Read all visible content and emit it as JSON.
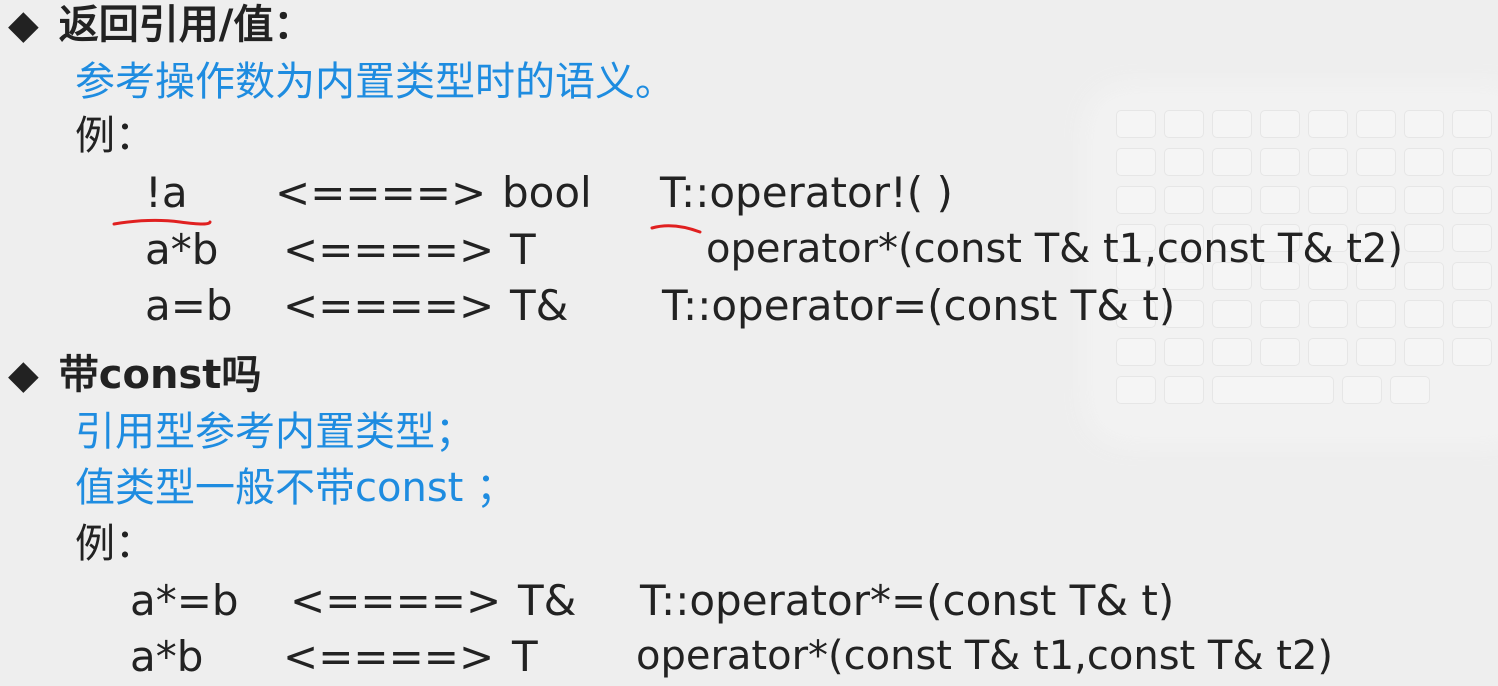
{
  "section1": {
    "bullet": "◆",
    "title": "返回引用/值：",
    "desc": "参考操作数为内置类型时的语义。",
    "example_label": "例：",
    "rows": [
      {
        "expr": "!a",
        "arrow": "<====>",
        "ret": "bool",
        "sig": "T::operator!( )"
      },
      {
        "expr": "a*b",
        "arrow": "<====>",
        "ret": "T",
        "sig": "operator*(const T& t1,const T& t2)"
      },
      {
        "expr": "a=b",
        "arrow": "<====>",
        "ret": "T&",
        "sig": "T::operator=(const T& t)"
      }
    ]
  },
  "section2": {
    "bullet": "◆",
    "title": "带const吗",
    "desc1": "引用型参考内置类型；",
    "desc2": "值类型一般不带const ；",
    "example_label": "例：",
    "rows": [
      {
        "expr": "a*=b",
        "arrow": "<====>",
        "ret": "T&",
        "sig": "T::operator*=(const T& t)"
      },
      {
        "expr": "a*b",
        "arrow": "<====>",
        "ret": "T",
        "sig": "operator*(const T& t1,const T& t2)"
      }
    ]
  },
  "colors": {
    "background": "#eeeeee",
    "text": "#222222",
    "accent_blue": "#1e8ce0",
    "annotation_red": "#e02020"
  }
}
